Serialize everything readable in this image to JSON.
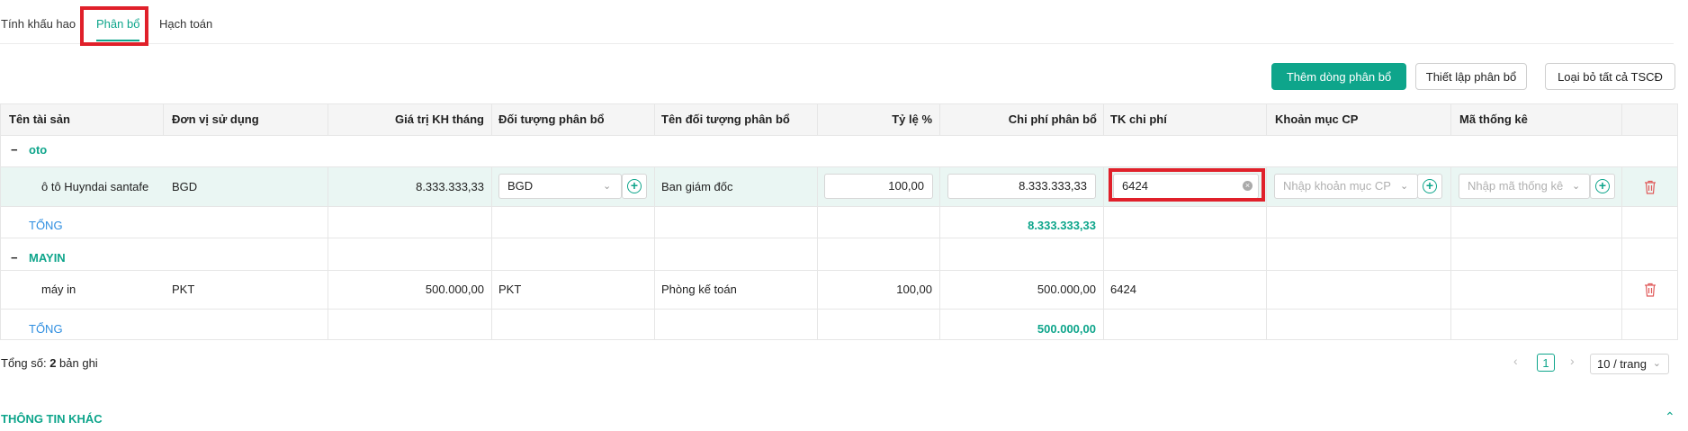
{
  "tabs": [
    {
      "label": "Tính khấu hao"
    },
    {
      "label": "Phân bổ"
    },
    {
      "label": "Hạch toán"
    }
  ],
  "toolbar": {
    "add_row_label": "Thêm dòng phân bổ",
    "setup_label": "Thiết lập phân bổ",
    "remove_all_label": "Loại bỏ tất cả TSCĐ"
  },
  "table": {
    "headers": [
      "Tên tài sản",
      "Đơn vị sử dụng",
      "Giá trị KH tháng",
      "Đối tượng phân bổ",
      "Tên đối tượng phân bổ",
      "Tỷ lệ %",
      "Chi phí phân bổ",
      "TK chi phí",
      "Khoản mục CP",
      "Mã thống kê"
    ],
    "groups": [
      {
        "collapse_icon": "−",
        "name": "oto",
        "row": {
          "asset": "ô tô Huyndai santafe",
          "unit": "BGD",
          "monthly_value": "8.333.333,33",
          "alloc_object": "BGD",
          "alloc_name": "Ban giám đốc",
          "ratio": "100,00",
          "cost": "8.333.333,33",
          "expense_account": "6424",
          "cost_item_placeholder": "Nhập khoản mục CP",
          "stat_code_placeholder": "Nhập mã thống kê"
        },
        "total_label": "TỔNG",
        "total_value": "8.333.333,33"
      },
      {
        "collapse_icon": "−",
        "name": "MAYIN",
        "row": {
          "asset": "máy in",
          "unit": "PKT",
          "monthly_value": "500.000,00",
          "alloc_object": "PKT",
          "alloc_name": "Phòng kế toán",
          "ratio": "100,00",
          "cost": "500.000,00",
          "expense_account": "6424"
        },
        "total_label": "TỔNG",
        "total_value": "500.000,00"
      }
    ]
  },
  "footer": {
    "total_prefix": "Tổng số: ",
    "total_count": "2",
    "total_suffix": " bản ghi",
    "current_page": "1",
    "page_size": "10 / trang"
  },
  "section": {
    "title": "THÔNG TIN KHÁC"
  },
  "colors": {
    "accent": "#0ea58b",
    "highlight": "#e0202a",
    "total_link": "#2e8ee0",
    "danger": "#e05a5a"
  }
}
